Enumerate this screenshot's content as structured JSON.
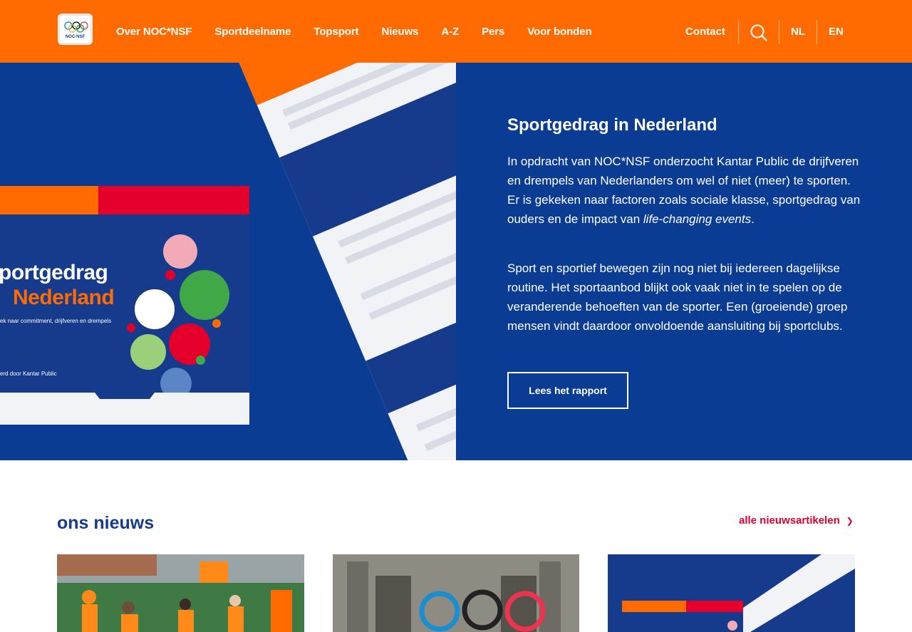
{
  "header": {
    "logo_text": "NOC·NSF",
    "nav": [
      "Over NOC*NSF",
      "Sportdeelname",
      "Topsport",
      "Nieuws",
      "A-Z",
      "Pers",
      "Voor bonden"
    ],
    "contact": "Contact",
    "lang_nl": "NL",
    "lang_en": "EN",
    "search_icon": "search-icon"
  },
  "hero": {
    "title": "Sportgedrag in Nederland",
    "p1_start": "In opdracht van NOC*NSF onderzocht Kantar Public de drijfveren en drempels van Nederlanders om wel of niet (meer) te sporten. Er is gekeken naar factoren zoals sociale klasse, sportgedrag van ouders en de impact van ",
    "p1_em": "life-changing events",
    "p1_end": ".",
    "p2": "Sport en sportief bewegen zijn nog niet bij iedereen dagelijkse routine. Het sportaanbod blijkt ook vaak niet in te spelen op de veranderende behoeften van de sporter. Een (groeiende) groep mensen vindt daardoor onvoldoende aansluiting bij sportclubs.",
    "cta": "Lees het rapport",
    "cover_title_line1": "portgedrag",
    "cover_title_line2": "Nederland",
    "cover_sub": "ek naar commitment, drijfveren en drempels",
    "cover_foot": "erd door Kantar Public"
  },
  "news": {
    "title": "ons nieuws",
    "all_link": "alle nieuwsartikelen",
    "chevron_icon": "chevron-right-icon"
  },
  "colors": {
    "orange": "#ff6b00",
    "blue": "#0a3c93",
    "navy": "#163b8c",
    "red": "#e4002b"
  }
}
